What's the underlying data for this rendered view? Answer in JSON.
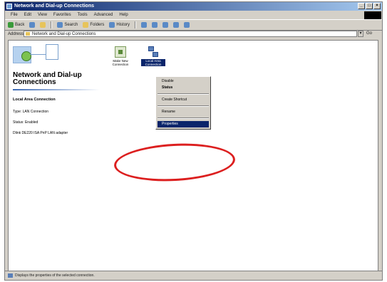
{
  "window": {
    "title": "Network and Dial-up Connections",
    "controls": [
      "_",
      "□",
      "×"
    ]
  },
  "menubar": {
    "items": [
      "File",
      "Edit",
      "View",
      "Favorites",
      "Tools",
      "Advanced",
      "Help"
    ]
  },
  "toolbar": {
    "back_label": "Back",
    "search_label": "Search",
    "folders_label": "Folders",
    "history_label": "History"
  },
  "address": {
    "label": "Address",
    "value": "Network and Dial-up Connections",
    "go_label": "Go"
  },
  "sidebar": {
    "title": "Network and Dial-up Connections",
    "selected_name": "Local Area Connection",
    "type_line": "Type: LAN Connection",
    "status_line": "Status: Enabled",
    "device_line": "Dlink DE220 ISA PnP LAN adapter"
  },
  "icons": {
    "make_new_label": "Make New Connection",
    "lan_label": "Local Area Connection"
  },
  "context_menu": {
    "items": [
      {
        "label": "Disable",
        "bold": false
      },
      {
        "label": "Status",
        "bold": true
      },
      {
        "label": "Create Shortcut",
        "bold": false
      },
      {
        "label": "Rename",
        "bold": false
      },
      {
        "label": "Properties",
        "bold": false
      }
    ],
    "selected": "Properties"
  },
  "statusbar": {
    "text": "Displays the properties of the selected connection."
  },
  "colors": {
    "title_bar": "#0a246a",
    "selection": "#0a246a",
    "annotation": "#dc1f1f"
  }
}
